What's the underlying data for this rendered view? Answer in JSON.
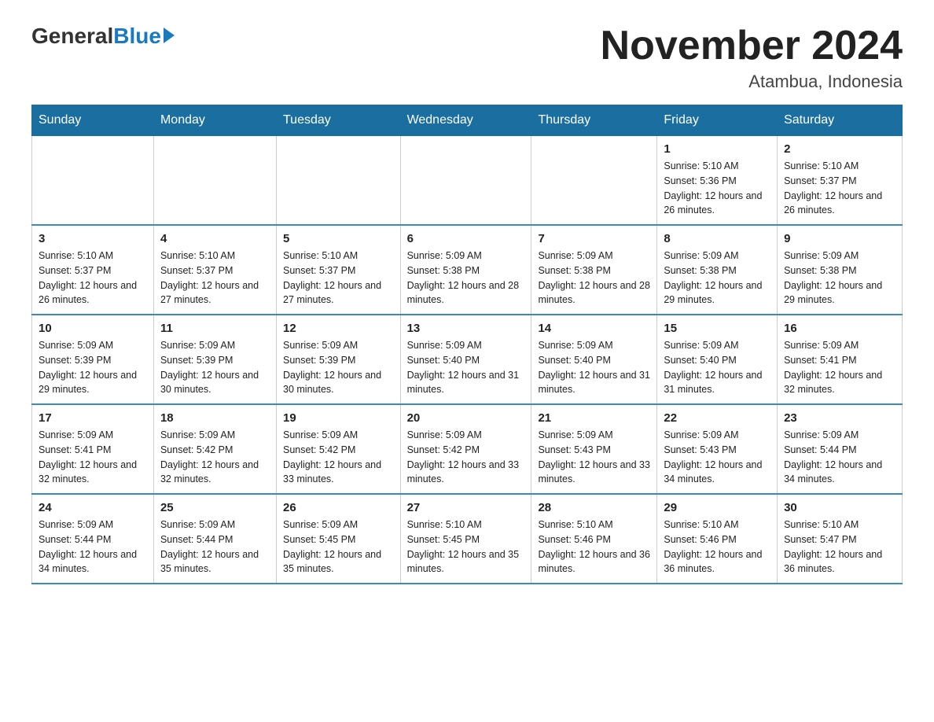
{
  "header": {
    "logo_general": "General",
    "logo_blue": "Blue",
    "title": "November 2024",
    "subtitle": "Atambua, Indonesia"
  },
  "weekdays": [
    "Sunday",
    "Monday",
    "Tuesday",
    "Wednesday",
    "Thursday",
    "Friday",
    "Saturday"
  ],
  "weeks": [
    [
      {
        "day": "",
        "sunrise": "",
        "sunset": "",
        "daylight": ""
      },
      {
        "day": "",
        "sunrise": "",
        "sunset": "",
        "daylight": ""
      },
      {
        "day": "",
        "sunrise": "",
        "sunset": "",
        "daylight": ""
      },
      {
        "day": "",
        "sunrise": "",
        "sunset": "",
        "daylight": ""
      },
      {
        "day": "",
        "sunrise": "",
        "sunset": "",
        "daylight": ""
      },
      {
        "day": "1",
        "sunrise": "Sunrise: 5:10 AM",
        "sunset": "Sunset: 5:36 PM",
        "daylight": "Daylight: 12 hours and 26 minutes."
      },
      {
        "day": "2",
        "sunrise": "Sunrise: 5:10 AM",
        "sunset": "Sunset: 5:37 PM",
        "daylight": "Daylight: 12 hours and 26 minutes."
      }
    ],
    [
      {
        "day": "3",
        "sunrise": "Sunrise: 5:10 AM",
        "sunset": "Sunset: 5:37 PM",
        "daylight": "Daylight: 12 hours and 26 minutes."
      },
      {
        "day": "4",
        "sunrise": "Sunrise: 5:10 AM",
        "sunset": "Sunset: 5:37 PM",
        "daylight": "Daylight: 12 hours and 27 minutes."
      },
      {
        "day": "5",
        "sunrise": "Sunrise: 5:10 AM",
        "sunset": "Sunset: 5:37 PM",
        "daylight": "Daylight: 12 hours and 27 minutes."
      },
      {
        "day": "6",
        "sunrise": "Sunrise: 5:09 AM",
        "sunset": "Sunset: 5:38 PM",
        "daylight": "Daylight: 12 hours and 28 minutes."
      },
      {
        "day": "7",
        "sunrise": "Sunrise: 5:09 AM",
        "sunset": "Sunset: 5:38 PM",
        "daylight": "Daylight: 12 hours and 28 minutes."
      },
      {
        "day": "8",
        "sunrise": "Sunrise: 5:09 AM",
        "sunset": "Sunset: 5:38 PM",
        "daylight": "Daylight: 12 hours and 29 minutes."
      },
      {
        "day": "9",
        "sunrise": "Sunrise: 5:09 AM",
        "sunset": "Sunset: 5:38 PM",
        "daylight": "Daylight: 12 hours and 29 minutes."
      }
    ],
    [
      {
        "day": "10",
        "sunrise": "Sunrise: 5:09 AM",
        "sunset": "Sunset: 5:39 PM",
        "daylight": "Daylight: 12 hours and 29 minutes."
      },
      {
        "day": "11",
        "sunrise": "Sunrise: 5:09 AM",
        "sunset": "Sunset: 5:39 PM",
        "daylight": "Daylight: 12 hours and 30 minutes."
      },
      {
        "day": "12",
        "sunrise": "Sunrise: 5:09 AM",
        "sunset": "Sunset: 5:39 PM",
        "daylight": "Daylight: 12 hours and 30 minutes."
      },
      {
        "day": "13",
        "sunrise": "Sunrise: 5:09 AM",
        "sunset": "Sunset: 5:40 PM",
        "daylight": "Daylight: 12 hours and 31 minutes."
      },
      {
        "day": "14",
        "sunrise": "Sunrise: 5:09 AM",
        "sunset": "Sunset: 5:40 PM",
        "daylight": "Daylight: 12 hours and 31 minutes."
      },
      {
        "day": "15",
        "sunrise": "Sunrise: 5:09 AM",
        "sunset": "Sunset: 5:40 PM",
        "daylight": "Daylight: 12 hours and 31 minutes."
      },
      {
        "day": "16",
        "sunrise": "Sunrise: 5:09 AM",
        "sunset": "Sunset: 5:41 PM",
        "daylight": "Daylight: 12 hours and 32 minutes."
      }
    ],
    [
      {
        "day": "17",
        "sunrise": "Sunrise: 5:09 AM",
        "sunset": "Sunset: 5:41 PM",
        "daylight": "Daylight: 12 hours and 32 minutes."
      },
      {
        "day": "18",
        "sunrise": "Sunrise: 5:09 AM",
        "sunset": "Sunset: 5:42 PM",
        "daylight": "Daylight: 12 hours and 32 minutes."
      },
      {
        "day": "19",
        "sunrise": "Sunrise: 5:09 AM",
        "sunset": "Sunset: 5:42 PM",
        "daylight": "Daylight: 12 hours and 33 minutes."
      },
      {
        "day": "20",
        "sunrise": "Sunrise: 5:09 AM",
        "sunset": "Sunset: 5:42 PM",
        "daylight": "Daylight: 12 hours and 33 minutes."
      },
      {
        "day": "21",
        "sunrise": "Sunrise: 5:09 AM",
        "sunset": "Sunset: 5:43 PM",
        "daylight": "Daylight: 12 hours and 33 minutes."
      },
      {
        "day": "22",
        "sunrise": "Sunrise: 5:09 AM",
        "sunset": "Sunset: 5:43 PM",
        "daylight": "Daylight: 12 hours and 34 minutes."
      },
      {
        "day": "23",
        "sunrise": "Sunrise: 5:09 AM",
        "sunset": "Sunset: 5:44 PM",
        "daylight": "Daylight: 12 hours and 34 minutes."
      }
    ],
    [
      {
        "day": "24",
        "sunrise": "Sunrise: 5:09 AM",
        "sunset": "Sunset: 5:44 PM",
        "daylight": "Daylight: 12 hours and 34 minutes."
      },
      {
        "day": "25",
        "sunrise": "Sunrise: 5:09 AM",
        "sunset": "Sunset: 5:44 PM",
        "daylight": "Daylight: 12 hours and 35 minutes."
      },
      {
        "day": "26",
        "sunrise": "Sunrise: 5:09 AM",
        "sunset": "Sunset: 5:45 PM",
        "daylight": "Daylight: 12 hours and 35 minutes."
      },
      {
        "day": "27",
        "sunrise": "Sunrise: 5:10 AM",
        "sunset": "Sunset: 5:45 PM",
        "daylight": "Daylight: 12 hours and 35 minutes."
      },
      {
        "day": "28",
        "sunrise": "Sunrise: 5:10 AM",
        "sunset": "Sunset: 5:46 PM",
        "daylight": "Daylight: 12 hours and 36 minutes."
      },
      {
        "day": "29",
        "sunrise": "Sunrise: 5:10 AM",
        "sunset": "Sunset: 5:46 PM",
        "daylight": "Daylight: 12 hours and 36 minutes."
      },
      {
        "day": "30",
        "sunrise": "Sunrise: 5:10 AM",
        "sunset": "Sunset: 5:47 PM",
        "daylight": "Daylight: 12 hours and 36 minutes."
      }
    ]
  ]
}
